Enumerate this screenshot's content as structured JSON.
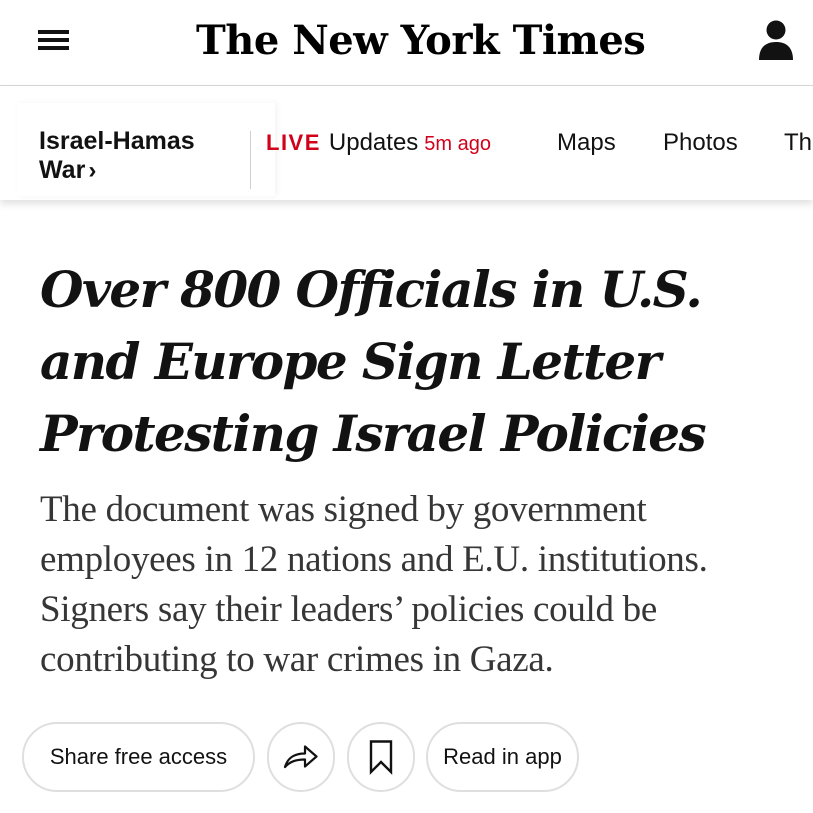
{
  "masthead": {
    "logo_text": "The New York Times",
    "menu_icon": "hamburger-menu-icon",
    "account_icon": "account-person-icon"
  },
  "section_nav": {
    "topic": {
      "label": "Israel-Hamas War",
      "chevron": "›"
    },
    "live": {
      "badge": "LIVE",
      "label": "Updates",
      "time": "5m ago",
      "color": "#d0021b"
    },
    "items": [
      {
        "label": "Maps"
      },
      {
        "label": "Photos"
      },
      {
        "label": "Th"
      }
    ]
  },
  "article": {
    "headline": "Over 800 Officials in U.S. and Europe Sign Letter Protesting Israel Policies",
    "summary": "The document was signed by government employees in 12 nations and E.U. institutions. Signers say their leaders’ policies could be contributing to war crimes in Gaza."
  },
  "actions": {
    "share_free_access": "Share free access",
    "share_icon": "share-arrow-icon",
    "save_icon": "bookmark-icon",
    "read_in_app": "Read in app"
  }
}
